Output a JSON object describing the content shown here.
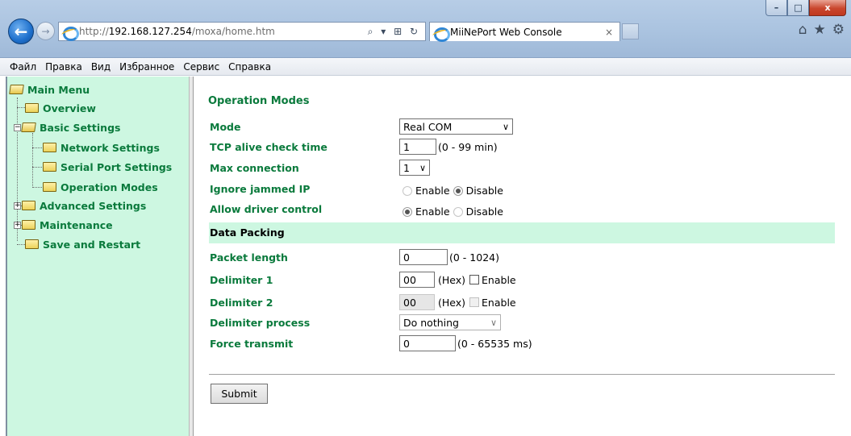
{
  "browser": {
    "url_prefix": "http://",
    "url_host": "192.168.127.254",
    "url_path": "/moxa/home.htm",
    "address_icons": "⌕ ▾ ⊞ ↻",
    "tab_title": "MiiNePort Web Console",
    "tab_close": "×",
    "win_min": "–",
    "win_max": "□",
    "win_close": "x"
  },
  "menubar": {
    "items": [
      "Файл",
      "Правка",
      "Вид",
      "Избранное",
      "Сервис",
      "Справка"
    ]
  },
  "sidebar": {
    "main_menu": "Main Menu",
    "overview": "Overview",
    "basic_settings": "Basic Settings",
    "network_settings": "Network Settings",
    "serial_port_settings": "Serial Port Settings",
    "operation_modes": "Operation Modes",
    "advanced_settings": "Advanced Settings",
    "maintenance": "Maintenance",
    "save_and_restart": "Save and Restart"
  },
  "form": {
    "title": "Operation Modes",
    "mode_label": "Mode",
    "mode_value": "Real COM",
    "tcp_alive_label": "TCP alive check time",
    "tcp_alive_value": "1",
    "tcp_alive_range": "(0 - 99 min)",
    "max_conn_label": "Max connection",
    "max_conn_value": "1",
    "ignore_jammed_label": "Ignore jammed IP",
    "ignore_jammed_enable": "Enable",
    "ignore_jammed_disable": "Disable",
    "ignore_jammed_selected": "Disable",
    "allow_driver_label": "Allow driver control",
    "allow_driver_enable": "Enable",
    "allow_driver_disable": "Disable",
    "allow_driver_selected": "Enable",
    "data_packing_title": "Data Packing",
    "packet_length_label": "Packet length",
    "packet_length_value": "0",
    "packet_length_range": "(0 - 1024)",
    "delim1_label": "Delimiter 1",
    "delim1_value": "00",
    "delim1_hex": "(Hex)",
    "delim1_enable": "Enable",
    "delim2_label": "Delimiter 2",
    "delim2_value": "00",
    "delim2_hex": "(Hex)",
    "delim2_enable": "Enable",
    "delim_process_label": "Delimiter process",
    "delim_process_value": "Do nothing",
    "force_transmit_label": "Force transmit",
    "force_transmit_value": "0",
    "force_transmit_range": "(0 - 65535 ms)",
    "submit_label": "Submit"
  }
}
